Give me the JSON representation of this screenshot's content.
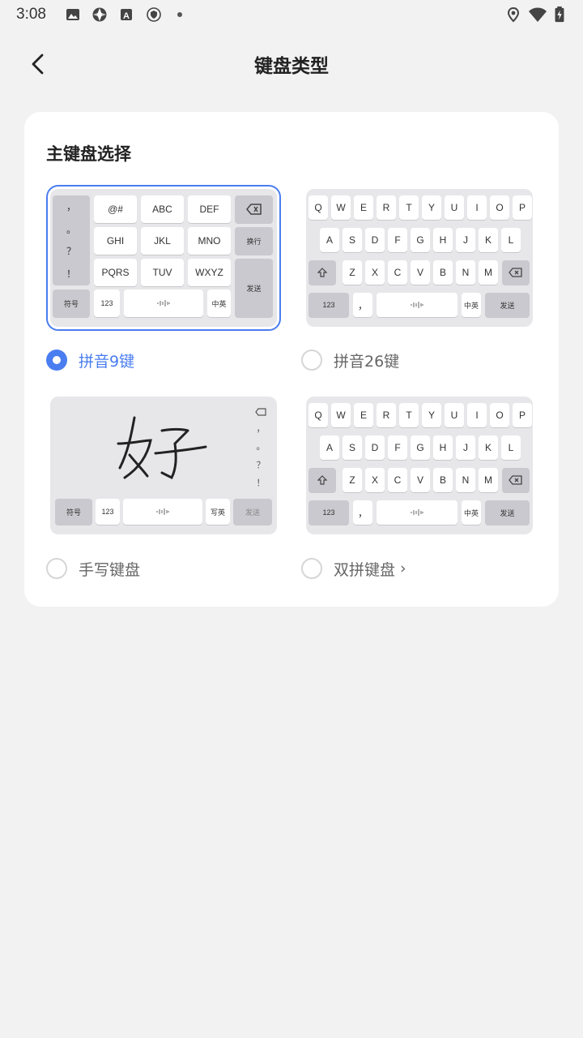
{
  "status_bar": {
    "time": "3:08"
  },
  "header": {
    "title": "键盘类型"
  },
  "main": {
    "section_title": "主键盘选择",
    "options": [
      {
        "label": "拼音9键",
        "selected": true
      },
      {
        "label": "拼音26键",
        "selected": false
      },
      {
        "label": "手写键盘",
        "selected": false
      },
      {
        "label": "双拼键盘",
        "selected": false,
        "chevron": "›"
      }
    ]
  },
  "keyboard_9": {
    "left_column": [
      "，",
      "。",
      "？",
      "！"
    ],
    "symbols": "符号",
    "keys": [
      "@#",
      "ABC",
      "DEF",
      "GHI",
      "JKL",
      "MNO",
      "PQRS",
      "TUV",
      "WXYZ"
    ],
    "newline": "换行",
    "send": "发送",
    "num": "123",
    "switch": "中英"
  },
  "keyboard_26": {
    "row1": [
      "Q",
      "W",
      "E",
      "R",
      "T",
      "Y",
      "U",
      "I",
      "O",
      "P"
    ],
    "row2": [
      "A",
      "S",
      "D",
      "F",
      "G",
      "H",
      "J",
      "K",
      "L"
    ],
    "row3": [
      "Z",
      "X",
      "C",
      "V",
      "B",
      "N",
      "M"
    ],
    "num": "123",
    "punct": "，",
    "switch": "中英",
    "send": "发送"
  },
  "keyboard_hw": {
    "char": "好",
    "side": [
      "，",
      "。",
      "？",
      "！"
    ],
    "symbols": "符号",
    "num": "123",
    "switch": "写英",
    "send": "发送"
  }
}
